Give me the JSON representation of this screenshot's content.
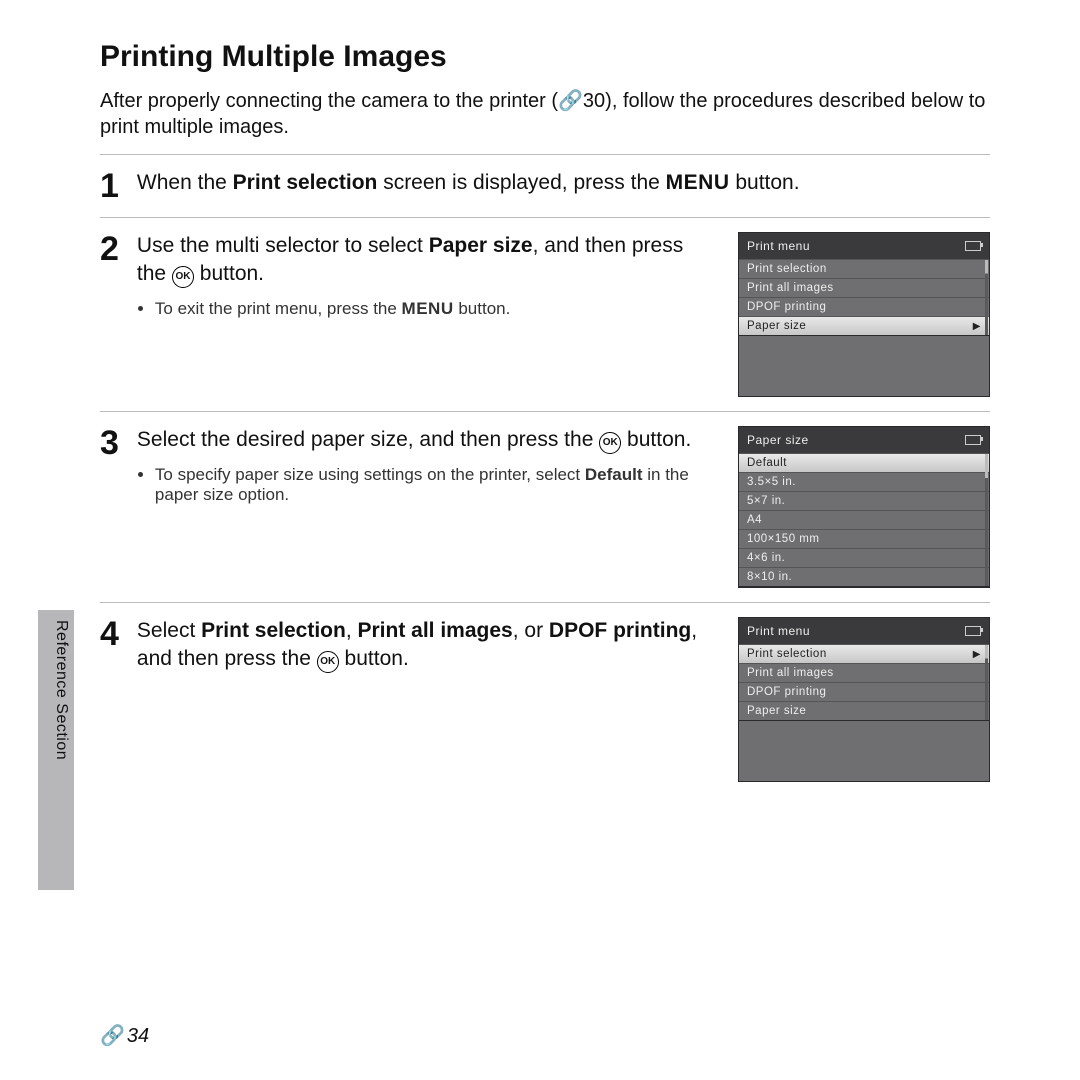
{
  "title": "Printing Multiple Images",
  "intro_pre": "After properly connecting the camera to the printer (",
  "intro_ref": "30",
  "intro_post": "), follow the procedures described below to print multiple images.",
  "side_label": "Reference Section",
  "page_number": "34",
  "step1": {
    "pre": "When the ",
    "bold": "Print selection",
    "mid": " screen is displayed, press the ",
    "menu": "MENU",
    "post": " button."
  },
  "step2": {
    "pre": "Use the multi selector to select ",
    "bold": "Paper size",
    "post": ", and then press the ",
    "post2": " button.",
    "bullet_pre": "To exit the print menu, press the ",
    "bullet_menu": "MENU",
    "bullet_post": " button."
  },
  "step3": {
    "line1": "Select the desired paper size, and then press the ",
    "line1_post": " button.",
    "bullet_pre": "To specify paper size using settings on the printer, select ",
    "bullet_bold": "Default",
    "bullet_post": " in the paper size option."
  },
  "step4": {
    "pre": "Select ",
    "b1": "Print selection",
    "sep1": ", ",
    "b2": "Print all images",
    "sep2": ", or ",
    "b3": "DPOF printing",
    "post": ", and then press the ",
    "post2": " button."
  },
  "screenA": {
    "title": "Print menu",
    "items": [
      "Print selection",
      "Print all images",
      "DPOF printing",
      "Paper size"
    ],
    "highlight_index": 3
  },
  "screenB": {
    "title": "Paper size",
    "items": [
      "Default",
      "3.5×5 in.",
      "5×7 in.",
      "A4",
      "100×150 mm",
      "4×6 in.",
      "8×10 in."
    ],
    "highlight_index": 0
  },
  "screenC": {
    "title": "Print menu",
    "items": [
      "Print selection",
      "Print all images",
      "DPOF printing",
      "Paper size"
    ],
    "highlight_index": 0
  }
}
